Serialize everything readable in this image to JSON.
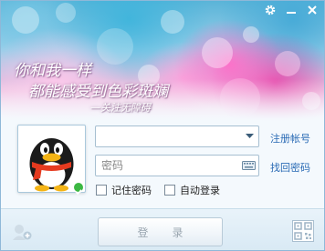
{
  "window": {
    "title_buttons": {
      "settings_icon": "gear-icon",
      "minimize_icon": "minimize-icon",
      "close_icon": "close-icon"
    }
  },
  "banner": {
    "slogan_line1": "你和我一样",
    "slogan_line2": "都能感受到色彩斑斓",
    "slogan_signature": "—关注无障碍"
  },
  "login": {
    "account": {
      "value": "",
      "placeholder": ""
    },
    "password": {
      "value": "",
      "placeholder": "密码"
    },
    "register_link": "注册帐号",
    "recover_link": "找回密码",
    "remember_password": {
      "label": "记住密码",
      "checked": false
    },
    "auto_login": {
      "label": "自动登录",
      "checked": false
    },
    "login_button": "登录"
  },
  "icons": {
    "avatar": "penguin-avatar",
    "status": "online-status-icon",
    "dropdown": "chevron-down-icon",
    "keyboard": "keyboard-icon",
    "multi_account": "multi-account-icon",
    "qr": "qr-code-icon"
  },
  "colors": {
    "link": "#2a6bb5",
    "online_status": "#3cb843"
  }
}
